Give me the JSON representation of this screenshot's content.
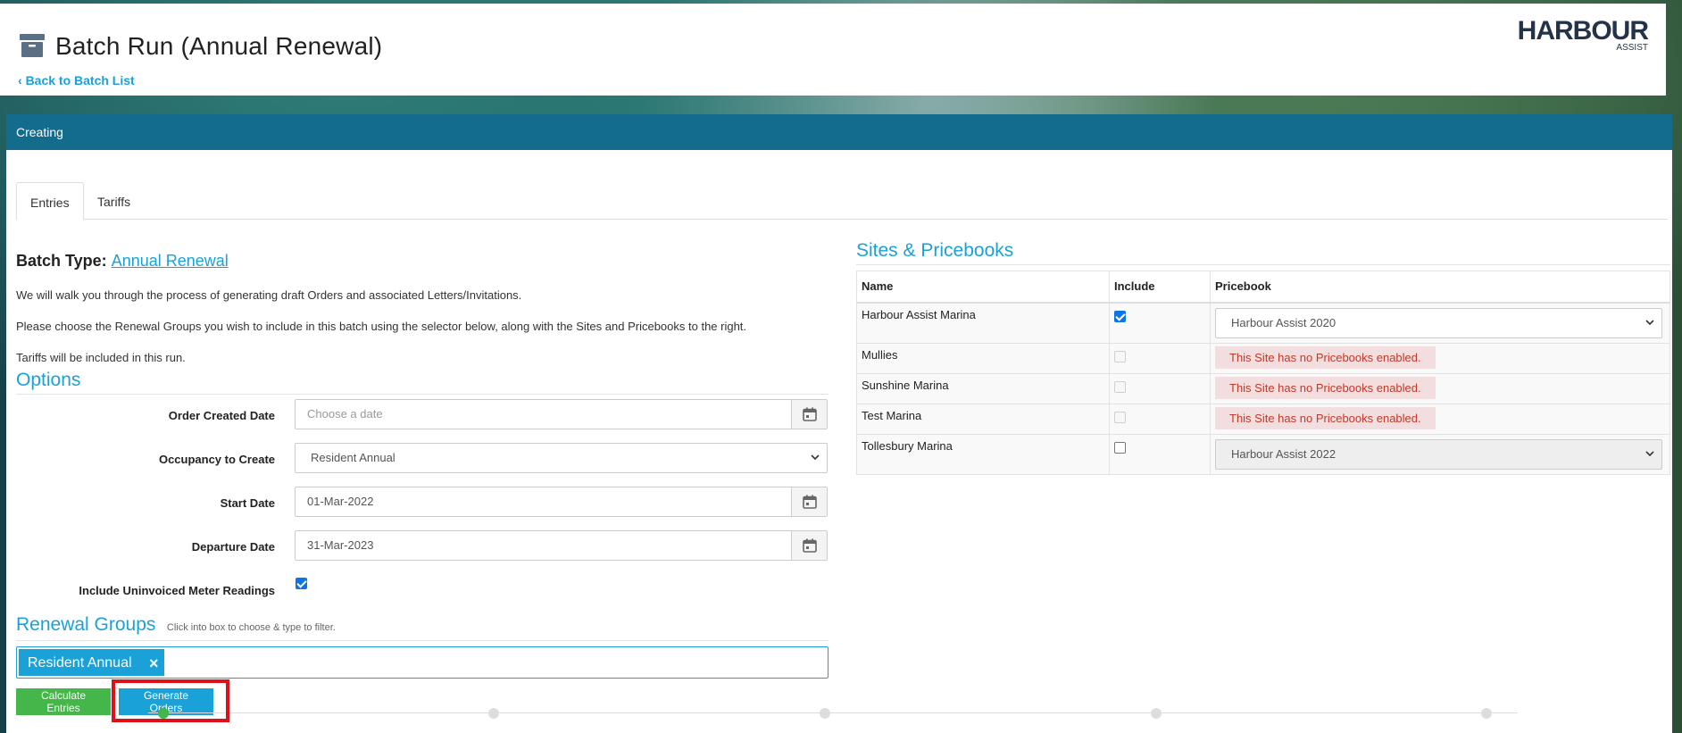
{
  "header": {
    "title": "Batch Run (Annual Renewal)",
    "back_link": "Back to Batch List",
    "logo_main": "HARBOUR",
    "logo_sub": "ASSIST"
  },
  "status": "Creating",
  "tabs": [
    {
      "label": "Entries",
      "active": true
    },
    {
      "label": "Tariffs",
      "active": false
    }
  ],
  "batch": {
    "type_label": "Batch Type:",
    "type_value": "Annual Renewal",
    "intro": [
      "We will walk you through the process of generating draft Orders and associated Letters/Invitations.",
      "Please choose the Renewal Groups you wish to include in this batch using the selector below, along with the Sites and Pricebooks to the right.",
      "Tariffs will be included in this run."
    ]
  },
  "options": {
    "heading": "Options",
    "order_created_date": {
      "label": "Order Created Date",
      "placeholder": "Choose a date"
    },
    "occupancy": {
      "label": "Occupancy to Create",
      "value": "Resident Annual"
    },
    "start_date": {
      "label": "Start Date",
      "value": "01-Mar-2022"
    },
    "departure_date": {
      "label": "Departure Date",
      "value": "31-Mar-2023"
    },
    "meter_readings": {
      "label": "Include Uninvoiced Meter Readings",
      "checked": true
    }
  },
  "renewal_groups": {
    "heading": "Renewal Groups",
    "hint": "Click into box to choose & type to filter.",
    "tags": [
      "Resident Annual"
    ]
  },
  "buttons": {
    "calculate": "Calculate Entries",
    "generate": "Generate Orders"
  },
  "sites": {
    "heading": "Sites & Pricebooks",
    "columns": [
      "Name",
      "Include",
      "Pricebook"
    ],
    "rows": [
      {
        "name": "Harbour Assist Marina",
        "include": true,
        "pricebook": "Harbour Assist 2020"
      },
      {
        "name": "Mullies",
        "include": false,
        "warning": "This Site has no Pricebooks enabled."
      },
      {
        "name": "Sunshine Marina",
        "include": false,
        "warning": "This Site has no Pricebooks enabled."
      },
      {
        "name": "Test Marina",
        "include": false,
        "warning": "This Site has no Pricebooks enabled."
      },
      {
        "name": "Tollesbury Marina",
        "include": false,
        "pricebook": "Harbour Assist 2022"
      }
    ]
  },
  "colors": {
    "accent": "#1aa2d8",
    "status_bar": "#146c8c",
    "success": "#45b649",
    "highlight": "#e01018"
  }
}
